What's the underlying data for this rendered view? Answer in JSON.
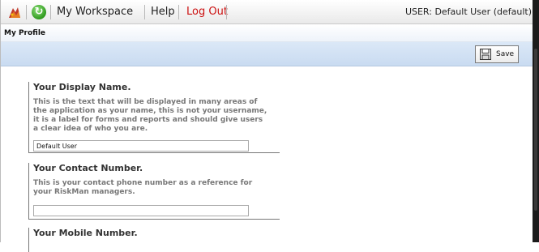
{
  "topnav": {
    "workspace_label": "My Workspace",
    "help_label": "Help",
    "logout_label": "Log Out",
    "user_info": "USER: Default User (default)"
  },
  "page": {
    "title": "My Profile"
  },
  "toolbar": {
    "save_label": "Save"
  },
  "sections": [
    {
      "heading": "Your Display Name.",
      "description": "This is the text that will be displayed in many areas of the application as your name, this is not your username, it is a label for forms and reports and should give users a clear idea of who you are.",
      "value": "Default User"
    },
    {
      "heading": "Your Contact Number.",
      "description": "This is your contact phone number as a reference for your RiskMan managers.",
      "value": ""
    },
    {
      "heading": "Your Mobile Number.",
      "description": "",
      "value": ""
    }
  ],
  "colors": {
    "logout": "#cc1111",
    "toolbar_bg": "#c9dbf1",
    "title_text": "#111111"
  },
  "icons": [
    "riskman-logo-icon",
    "refresh-icon",
    "save-disk-icon"
  ]
}
